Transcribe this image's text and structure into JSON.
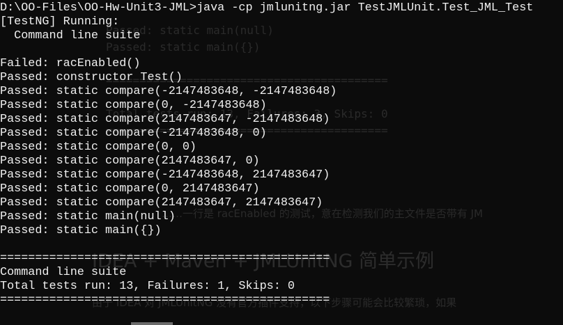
{
  "background_bleed": {
    "lines": [
      "Passed: static main(null)",
      "Passed: static main({})",
      "==========================================",
      "Total tests run: 13, Failures: 3, Skips: 0",
      "=========================================="
    ],
    "paragraph": "……一行是 racEnabled 的测试，意在检测我们的主文件是否带有 JM",
    "heading": "IDEA + Maven + JMLUnitNG 简单示例",
    "footer": "由于 IDEA 对 JMLUnitNG 没有官方插件支持，以下步骤可能会比较繁琐，如果"
  },
  "console": {
    "lines": [
      "D:\\OO-Files\\OO-Hw-Unit3-JML>java -cp jmlunitng.jar TestJMLUnit.Test_JML_Test",
      "[TestNG] Running:",
      "  Command line suite",
      "",
      "Failed: racEnabled()",
      "Passed: constructor Test()",
      "Passed: static compare(-2147483648, -2147483648)",
      "Passed: static compare(0, -2147483648)",
      "Passed: static compare(2147483647, -2147483648)",
      "Passed: static compare(-2147483648, 0)",
      "Passed: static compare(0, 0)",
      "Passed: static compare(2147483647, 0)",
      "Passed: static compare(-2147483648, 2147483647)",
      "Passed: static compare(0, 2147483647)",
      "Passed: static compare(2147483647, 2147483647)",
      "Passed: static main(null)",
      "Passed: static main({})",
      "",
      "===============================================",
      "Command line suite",
      "Total tests run: 13, Failures: 1, Skips: 0",
      "==============================================="
    ]
  },
  "colors": {
    "background": "#0c0c0c",
    "text": "#f0f0f0"
  }
}
